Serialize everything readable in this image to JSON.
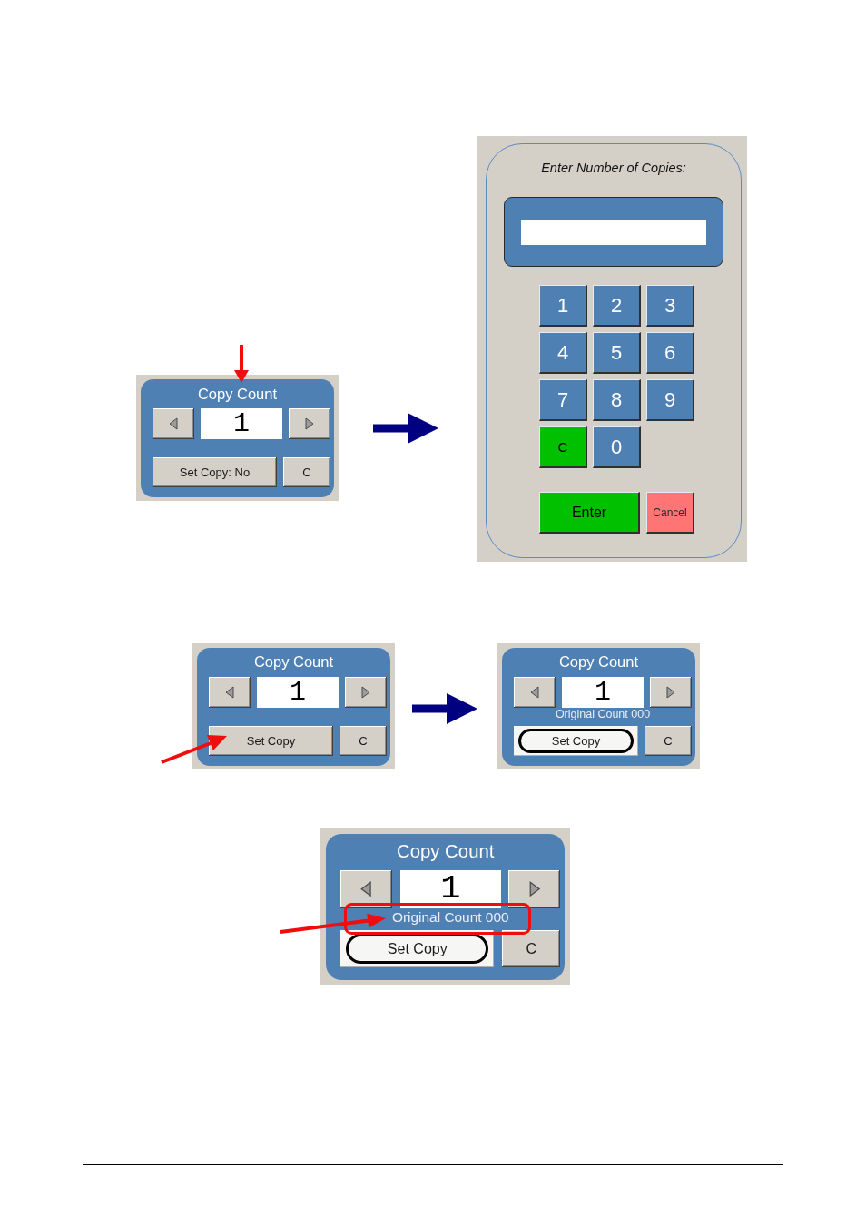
{
  "figures": [
    {
      "items": [
        {
          "kind": "panel",
          "title": "Copy Count",
          "value": "1",
          "set_copy": {
            "label": "Set Copy: No",
            "highlighted": false
          },
          "clear_label": "C"
        },
        {
          "kind": "keypad",
          "prompt": "Enter Number of Copies:",
          "keys": [
            {
              "label": "1",
              "kind": "digit"
            },
            {
              "label": "2",
              "kind": "digit"
            },
            {
              "label": "3",
              "kind": "digit"
            },
            {
              "label": "4",
              "kind": "digit"
            },
            {
              "label": "5",
              "kind": "digit"
            },
            {
              "label": "6",
              "kind": "digit"
            },
            {
              "label": "7",
              "kind": "digit"
            },
            {
              "label": "8",
              "kind": "digit"
            },
            {
              "label": "9",
              "kind": "digit"
            },
            {
              "label": "C",
              "kind": "clear"
            },
            {
              "label": "0",
              "kind": "digit"
            }
          ],
          "actions": [
            {
              "label": "Enter",
              "kind": "enter"
            },
            {
              "label": "Cancel",
              "kind": "cancel"
            }
          ]
        }
      ]
    },
    {
      "items": [
        {
          "kind": "panel",
          "title": "Copy Count",
          "value": "1",
          "set_copy": {
            "label": "Set Copy",
            "highlighted": false
          },
          "clear_label": "C"
        },
        {
          "kind": "panel",
          "title": "Copy Count",
          "value": "1",
          "original_count": "Original Count 000",
          "set_copy": {
            "label": "Set Copy",
            "highlighted": true
          },
          "clear_label": "C"
        }
      ]
    },
    {
      "items": [
        {
          "kind": "panel",
          "title": "Copy Count",
          "value": "1",
          "original_count": "Original Count 000",
          "set_copy": {
            "label": "Set Copy",
            "highlighted": true
          },
          "clear_label": "C"
        }
      ]
    }
  ]
}
